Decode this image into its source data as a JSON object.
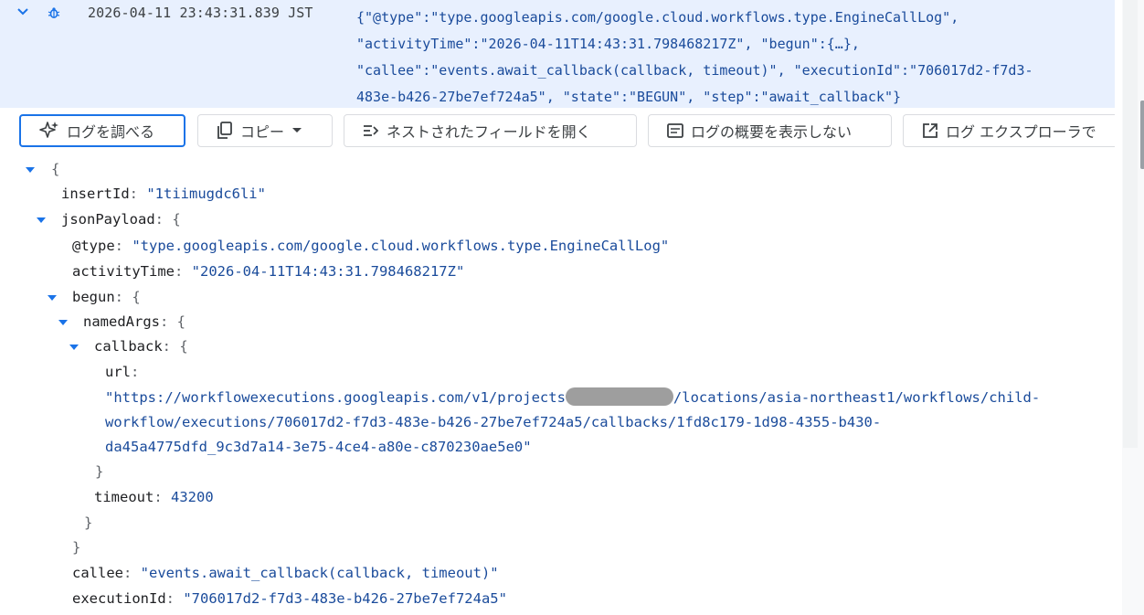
{
  "summary": {
    "timestamp": "2026-04-11 23:43:31.839 JST",
    "json_lines": [
      "{\"@type\":\"type.googleapis.com/google.cloud.workflows.type.EngineCallLog\",",
      "\"activityTime\":\"2026-04-11T14:43:31.798468217Z\", \"begun\":{…},",
      "\"callee\":\"events.await_callback(callback, timeout)\", \"executionId\":\"706017d2-f7d3-",
      "483e-b426-27be7ef724a5\", \"state\":\"BEGUN\", \"step\":\"await_callback\"}"
    ],
    "expand_icon": "chevron-down-icon",
    "severity_icon": "debug-bug-icon"
  },
  "toolbar": {
    "explain_label": "ログを調べる",
    "copy_label": "コピー",
    "expand_nested_label": "ネストされたフィールドを開く",
    "hide_summary_label": "ログの概要を表示しない",
    "log_explorer_label": "ログ エクスプローラで"
  },
  "tree": {
    "open_brace": "{",
    "insertId_key": "insertId",
    "insertId_value": "\"1tiimugdc6li\"",
    "jsonPayload_key": "jsonPayload",
    "type_key": "@type",
    "type_value": "\"type.googleapis.com/google.cloud.workflows.type.EngineCallLog\"",
    "activityTime_key": "activityTime",
    "activityTime_value": "\"2026-04-11T14:43:31.798468217Z\"",
    "begun_key": "begun",
    "namedArgs_key": "namedArgs",
    "callback_key": "callback",
    "url_key": "url",
    "url_line1_a": "\"https://workflowexecutions.googleapis.com/v1/projects",
    "url_line1_b": "/locations/asia-northeast1/workflows/child-",
    "url_line2": "workflow/executions/706017d2-f7d3-483e-b426-27be7ef724a5/callbacks/1fd8c179-1d98-4355-b430-",
    "url_line3": "da45a4775dfd_9c3d7a14-3e75-4ce4-a80e-c870230ae5e0\"",
    "close_brace": "}",
    "timeout_key": "timeout",
    "timeout_value": "43200",
    "callee_key": "callee",
    "callee_value": "\"events.await_callback(callback, timeout)\"",
    "executionId_key": "executionId",
    "executionId_value": "\"706017d2-f7d3-483e-b426-27be7ef724a5\""
  },
  "colors": {
    "summary_bg": "#e8f0fe",
    "accent": "#1a73e8",
    "string_value": "#1a4b9b"
  }
}
